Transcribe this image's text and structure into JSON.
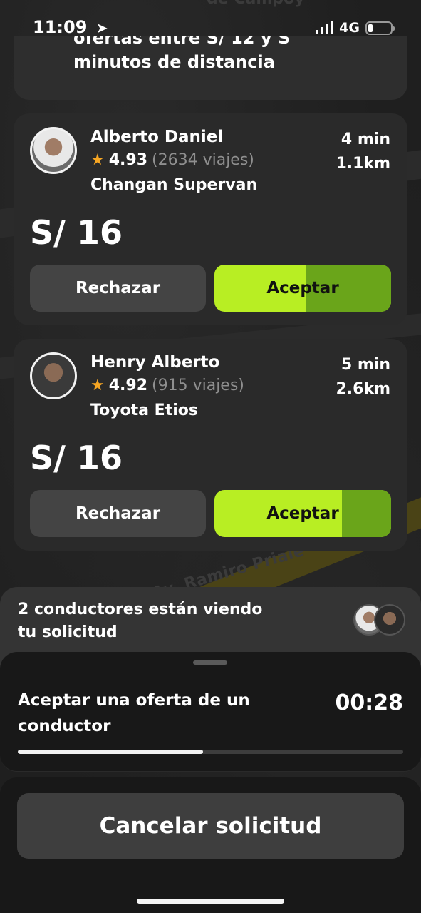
{
  "status_bar": {
    "time": "11:09",
    "network": "4G",
    "battery_level": 0.2
  },
  "map": {
    "street_top": "de Campoy",
    "street_bottom": "Av. Ramiro Priale"
  },
  "info_card": {
    "line1": "ofertas entre S/ 12 y S",
    "line2": "minutos de distancia"
  },
  "offers": [
    {
      "driver_name": "Alberto Daniel",
      "rating": "4.93",
      "trips": "(2634 viajes)",
      "car": "Changan Supervan",
      "eta": "4 min",
      "distance": "1.1km",
      "price": "S/ 16",
      "reject_label": "Rechazar",
      "accept_label": "Aceptar",
      "accept_timer_remaining": 0.48
    },
    {
      "driver_name": "Henry Alberto",
      "rating": "4.92",
      "trips": "(915 viajes)",
      "car": "Toyota Etios",
      "eta": "5 min",
      "distance": "2.6km",
      "price": "S/ 16",
      "reject_label": "Rechazar",
      "accept_label": "Aceptar",
      "accept_timer_remaining": 0.28
    }
  ],
  "viewing": {
    "text": "2 conductores están viendo tu solicitud"
  },
  "sheet": {
    "title": "Aceptar una oferta de un conductor",
    "countdown": "00:28",
    "progress": 0.48
  },
  "cancel_label": "Cancelar solicitud",
  "colors": {
    "accept": "#b8ee23",
    "accept_timer": "#6aa51a",
    "star": "#f6a623"
  }
}
